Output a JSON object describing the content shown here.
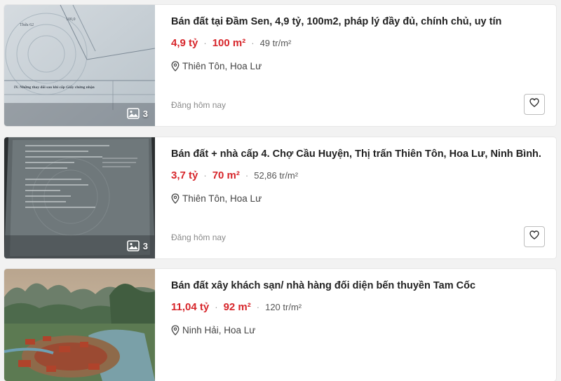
{
  "listings": [
    {
      "title": "Bán đất tại Đầm Sen, 4,9 tỷ, 100m2, pháp lý đầy đủ, chính chủ, uy tín",
      "price": "4,9 tỷ",
      "area": "100 m²",
      "price_per_m2": "49 tr/m²",
      "location": "Thiên Tôn, Hoa Lư",
      "posted": "Đăng hôm nay",
      "photo_count": "3",
      "thumb_lines": [
        "Thửa 62",
        "100,0",
        "IV. Những thay đổi sau khi cấp Giấy chứng nhận"
      ]
    },
    {
      "title": "Bán đất + nhà cấp 4. Chợ Cầu Huyện, Thị trấn Thiên Tôn, Hoa Lư, Ninh Bình.",
      "price": "3,7 tỷ",
      "area": "70 m²",
      "price_per_m2": "52,86 tr/m²",
      "location": "Thiên Tôn, Hoa Lư",
      "posted": "Đăng hôm nay",
      "photo_count": "3"
    },
    {
      "title": "Bán đất xây khách sạn/ nhà hàng đối diện bến thuyền Tam Cốc",
      "price": "11,04 tỷ",
      "area": "92 m²",
      "price_per_m2": "120 tr/m²",
      "location": "Ninh Hải, Hoa Lư"
    }
  ],
  "icons": {
    "photo": "image-icon",
    "location": "location-pin-icon",
    "save": "heart-icon"
  },
  "colors": {
    "price": "#d7262b",
    "background": "#f2f2f2"
  }
}
